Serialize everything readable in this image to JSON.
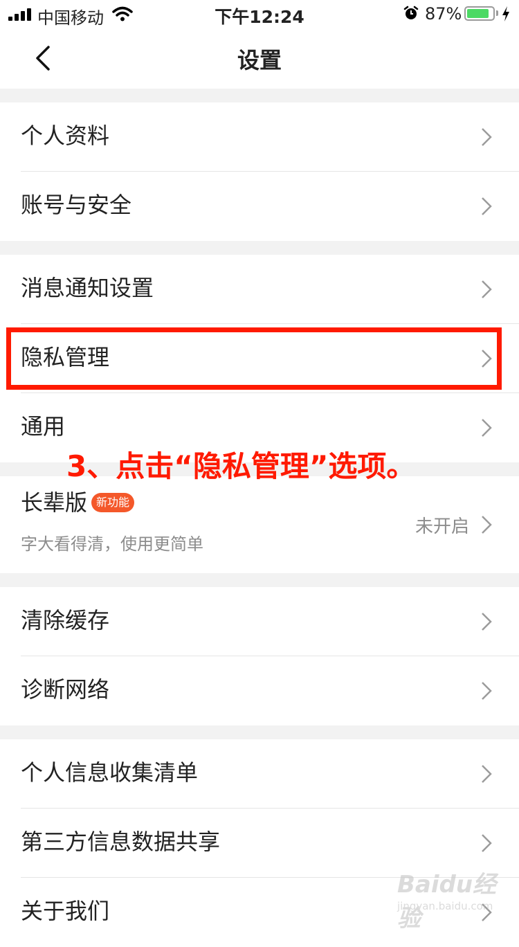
{
  "status_bar": {
    "carrier": "中国移动",
    "time": "下午12:24",
    "battery": "87%",
    "battery_level": 0.87,
    "battery_color": "#4cd964"
  },
  "nav": {
    "title": "设置",
    "back_icon": "chevron-left-icon"
  },
  "groups": [
    {
      "items": [
        {
          "label": "个人资料"
        },
        {
          "label": "账号与安全"
        }
      ]
    },
    {
      "items": [
        {
          "label": "消息通知设置"
        },
        {
          "label": "隐私管理"
        },
        {
          "label": "通用"
        }
      ]
    },
    {
      "items": [
        {
          "label": "长辈版",
          "badge": "新功能",
          "subtitle": "字大看得清，使用更简单",
          "value": "未开启"
        }
      ]
    },
    {
      "items": [
        {
          "label": "清除缓存"
        },
        {
          "label": "诊断网络"
        }
      ]
    },
    {
      "items": [
        {
          "label": "个人信息收集清单"
        },
        {
          "label": "第三方信息数据共享"
        },
        {
          "label": "关于我们"
        }
      ]
    }
  ],
  "annotation": {
    "text": "3、点击“隐私管理”选项。",
    "color": "#ff1a00"
  },
  "watermark": {
    "logo": "Baidu经验",
    "url": "jingyan.baidu.com"
  },
  "colors": {
    "badge": "#f4582a",
    "background": "#f2f2f2"
  }
}
